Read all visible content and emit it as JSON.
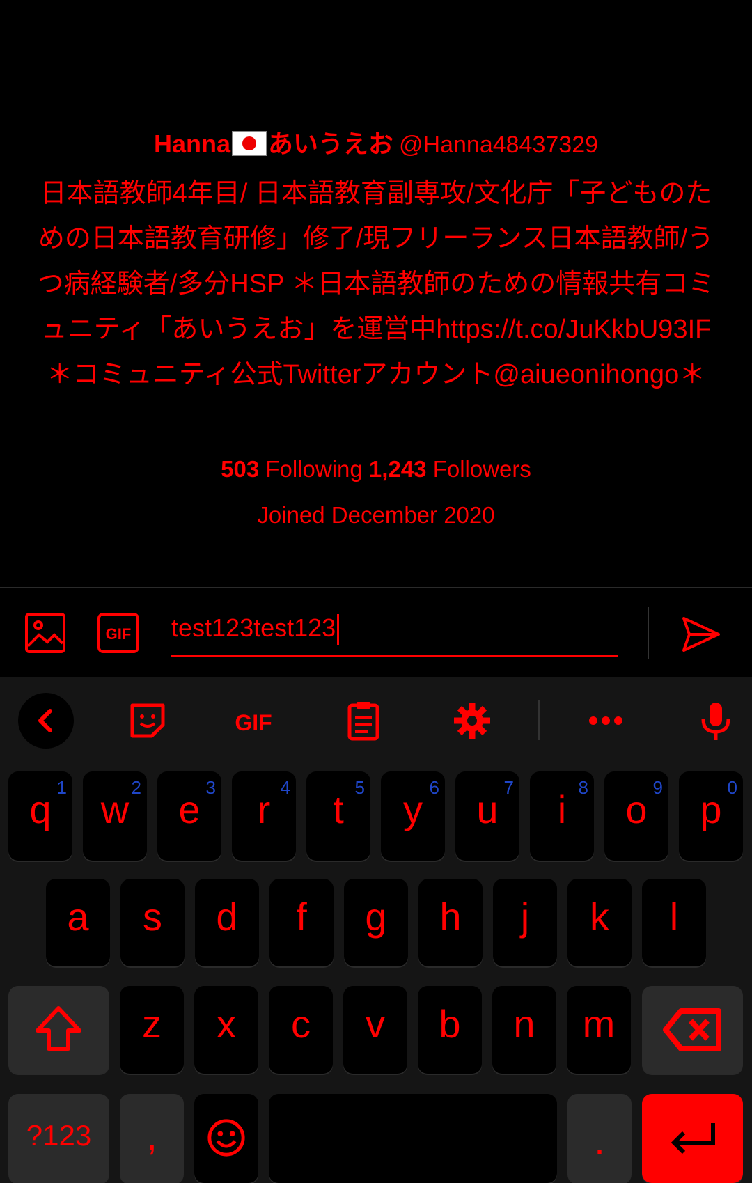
{
  "profile": {
    "name": "Hanna",
    "name_suffix": "あいうえお",
    "handle": "@Hanna48437329",
    "bio": "日本語教師4年目/ 日本語教育副専攻/文化庁「子どものための日本語教育研修」修了/現フリーランス日本語教師/うつ病経験者/多分HSP ＊日本語教師のための情報共有コミュニティ「あいうえお」を運営中https://t.co/JuKkbU93IF＊コミュニティ公式Twitterアカウント@aiueonihongo＊",
    "following_count": "503",
    "following_label": "Following",
    "followers_count": "1,243",
    "followers_label": "Followers",
    "joined": "Joined December 2020"
  },
  "compose": {
    "input_value": "test123test123",
    "image_icon": "image-icon",
    "gif_icon": "gif-icon",
    "send_icon": "send-icon"
  },
  "keyboard": {
    "toolbar": [
      "back-icon",
      "sticker-icon",
      "gif-icon",
      "clipboard-icon",
      "gear-icon",
      "more-icon",
      "mic-icon"
    ],
    "gif_label": "GIF",
    "row1": [
      {
        "ch": "q",
        "hint": "1"
      },
      {
        "ch": "w",
        "hint": "2"
      },
      {
        "ch": "e",
        "hint": "3"
      },
      {
        "ch": "r",
        "hint": "4"
      },
      {
        "ch": "t",
        "hint": "5"
      },
      {
        "ch": "y",
        "hint": "6"
      },
      {
        "ch": "u",
        "hint": "7"
      },
      {
        "ch": "i",
        "hint": "8"
      },
      {
        "ch": "o",
        "hint": "9"
      },
      {
        "ch": "p",
        "hint": "0"
      }
    ],
    "row2": [
      "a",
      "s",
      "d",
      "f",
      "g",
      "h",
      "j",
      "k",
      "l"
    ],
    "row3": [
      "z",
      "x",
      "c",
      "v",
      "b",
      "n",
      "m"
    ],
    "symbols_label": "?123",
    "comma_label": ",",
    "period_label": ".",
    "accent_color": "#ff0000",
    "hint_color": "#1f46c8"
  }
}
